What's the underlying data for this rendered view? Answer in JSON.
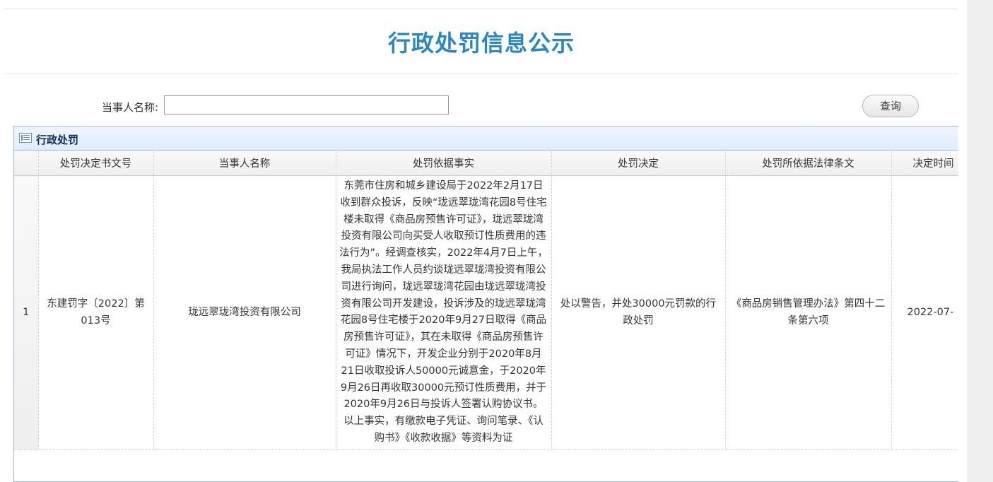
{
  "page": {
    "title": "行政处罚信息公示"
  },
  "search": {
    "label": "当事人名称:",
    "value": "",
    "placeholder": "",
    "button_label": "查询"
  },
  "panel": {
    "title": "行政处罚",
    "icon": "list-icon"
  },
  "table": {
    "columns": [
      "",
      "处罚决定书文号",
      "当事人名称",
      "处罚依据事实",
      "处罚决定",
      "处罚所依据法律条文",
      "决定时间"
    ],
    "rows": [
      {
        "index": "1",
        "doc_no": "东建罚字〔2022〕第013号",
        "party": "珑远翠珑湾投资有限公司",
        "facts": "东莞市住房和城乡建设局于2022年2月17日收到群众投诉，反映“珑远翠珑湾花园8号住宅楼未取得《商品房预售许可证》，珑远翠珑湾投资有限公司向买受人收取预订性质费用的违法行为”。经调查核实，2022年4月7日上午，我局执法工作人员约谈珑远翠珑湾投资有限公司进行询问，珑远翠珑湾花园由珑远翠珑湾投资有限公司开发建设，投诉涉及的珑远翠珑湾花园8号住宅楼于2020年9月27日取得《商品房预售许可证》，其在未取得《商品房预售许可证》情况下，开发企业分别于2020年8月21日收取投诉人50000元诚意金，于2020年9月26日再收取30000元预订性质费用，并于2020年9月26日与投诉人签署认购协议书。以上事实，有缴款电子凭证、询问笔录、《认购书》《收款收据》等资料为证",
        "decision": "处以警告，并处30000元罚款的行政处罚",
        "law": "《商品房销售管理办法》第四十二条第六项",
        "date": "2022-07-"
      }
    ]
  }
}
